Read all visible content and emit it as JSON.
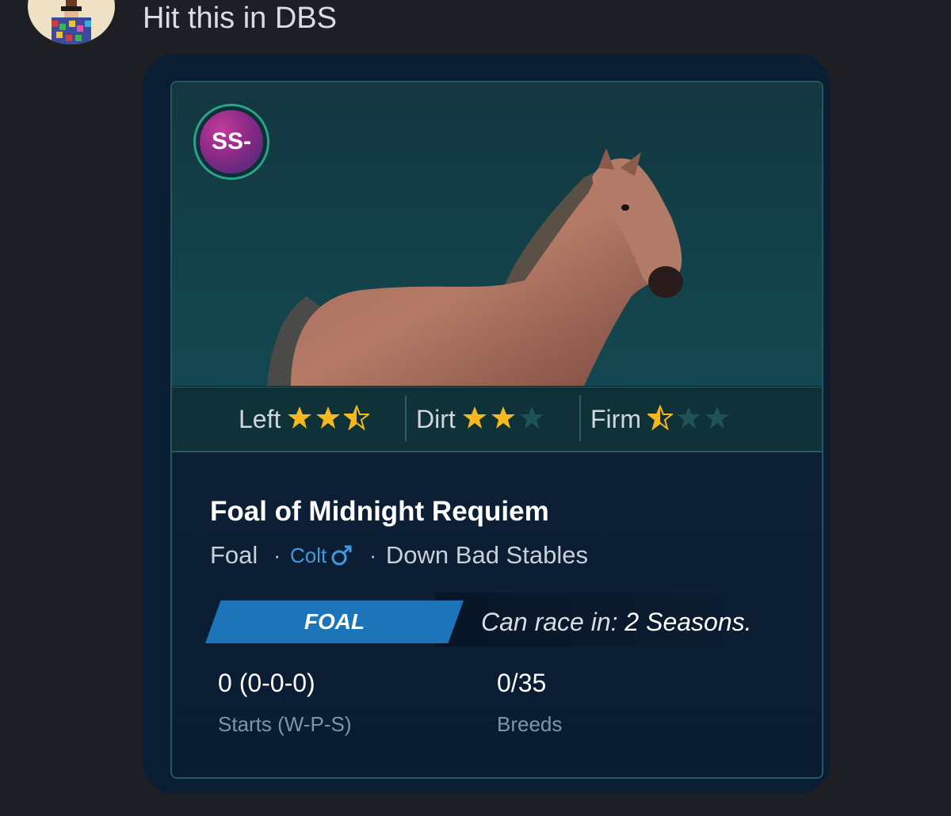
{
  "message": {
    "text": "Hit this in DBS"
  },
  "card": {
    "grade": "SS-",
    "ratings": [
      {
        "label": "Left",
        "stars": 2.5,
        "max": 3
      },
      {
        "label": "Dirt",
        "stars": 2,
        "max": 3
      },
      {
        "label": "Firm",
        "stars": 0.5,
        "max": 3
      }
    ],
    "horse_name": "Foal of Midnight Requiem",
    "age_class": "Foal",
    "sex": "Colt",
    "stable": "Down Bad Stables",
    "status_badge": "FOAL",
    "race_prefix": "Can race in:",
    "race_value": "2 Seasons.",
    "stats": [
      {
        "value": "0 (0-0-0)",
        "label": "Starts (W-P-S)"
      },
      {
        "value": "0/35",
        "label": "Breeds"
      }
    ]
  },
  "colors": {
    "star_filled": "#f5b81e",
    "star_empty": "#1e5257",
    "accent": "#1b75b8",
    "male_symbol": "#3f9be0"
  },
  "icons": {
    "grade": "grade-badge-icon",
    "male": "male-symbol-icon",
    "star": "star-icon"
  }
}
